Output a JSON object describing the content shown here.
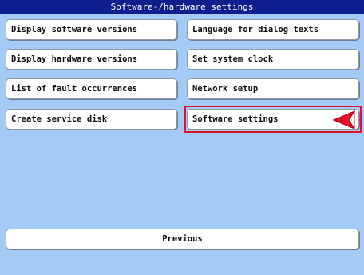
{
  "window": {
    "title": "Software-/hardware settings"
  },
  "buttons": {
    "display_software_versions": "Display software versions",
    "language_for_dialog_texts": "Language for dialog texts",
    "display_hardware_versions": "Display hardware versions",
    "set_system_clock": "Set system clock",
    "list_of_fault_occurrences": "List of fault occurrences",
    "network_setup": "Network setup",
    "create_service_disk": "Create service disk",
    "software_settings": "Software settings",
    "previous": "Previous"
  },
  "selection": {
    "selected_item": "software_settings",
    "indicator_icon": "pointer-arrow-icon",
    "indicator_color": "#e0102a"
  },
  "colors": {
    "background": "#a3cbf5",
    "title_bar": "#0d1f8f",
    "button_face": "#ffffff"
  }
}
